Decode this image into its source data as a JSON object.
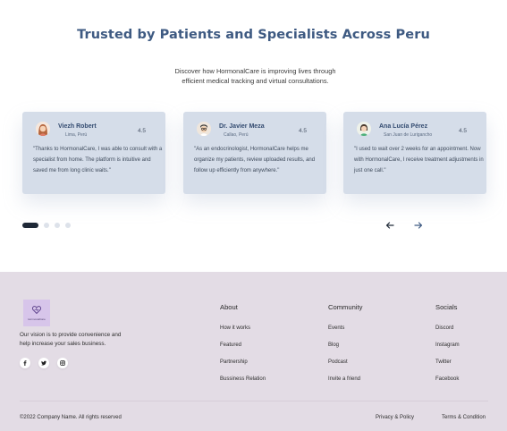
{
  "testimonials": {
    "title": "Trusted by Patients and Specialists Across Peru",
    "subtitle": "Discover how HormonalCare is improving lives through efficient medical tracking and virtual consultations.",
    "cards": [
      {
        "name": "Viezh Robert",
        "location": "Lima, Perú",
        "rating": "4.5",
        "text": "\"Thanks to HormonalCare, I was able to consult with a specialist from home. The platform is intuitive and saved me from long clinic waits.\"",
        "avatar_icon": "woman-avatar-icon"
      },
      {
        "name": "Dr. Javier Meza",
        "location": "Callao, Perú",
        "rating": "4.5",
        "text": "\"As an endocrinologist, HormonalCare helps me organize my patients, review uploaded results, and follow up efficiently from anywhere.\"",
        "avatar_icon": "man-glasses-avatar-icon"
      },
      {
        "name": "Ana Lucía Pérez",
        "location": "San Juan de Lurigancho",
        "rating": "4.5",
        "text": "\"I used to wait over 2 weeks for an appointment. Now with HormonalCare, I receive treatment adjustments in just one call.\"",
        "avatar_icon": "woman-green-avatar-icon"
      }
    ],
    "pagination": {
      "total": 4,
      "active": 1
    }
  },
  "footer": {
    "logo_text": "HormonalCare",
    "vision": "Our vision is to provide convenience and help increase your sales business.",
    "social_icons": [
      "facebook-icon",
      "twitter-icon",
      "instagram-icon"
    ],
    "columns": [
      {
        "title": "About",
        "links": [
          "How it works",
          "Featured",
          "Partnership",
          "Bussiness Relation"
        ]
      },
      {
        "title": "Community",
        "links": [
          "Events",
          "Blog",
          "Podcast",
          "Invite a friend"
        ]
      },
      {
        "title": "Socials",
        "links": [
          "Discord",
          "Instagram",
          "Twitter",
          "Facebook"
        ]
      }
    ],
    "copyright": "©2022 Company Name. All rights reserved",
    "privacy": "Privacy & Policy",
    "terms": "Terms & Condition"
  },
  "colors": {
    "title": "#3e5a82",
    "card_bg": "#d5dde9",
    "footer_bg": "#e3dce5",
    "logo_bg": "#d7c5ea"
  }
}
